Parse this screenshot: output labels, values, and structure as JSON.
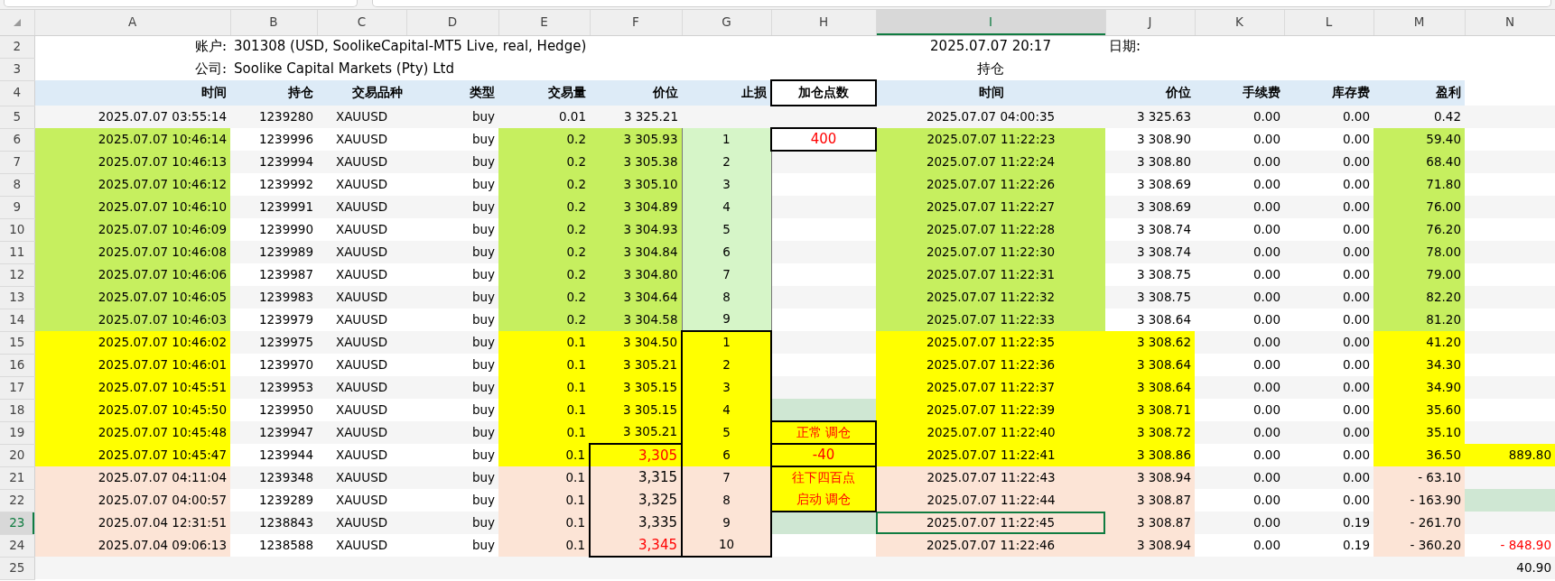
{
  "columns": [
    {
      "label": "A",
      "selected": false
    },
    {
      "label": "B",
      "selected": false
    },
    {
      "label": "C",
      "selected": false
    },
    {
      "label": "D",
      "selected": false
    },
    {
      "label": "E",
      "selected": false
    },
    {
      "label": "F",
      "selected": false
    },
    {
      "label": "G",
      "selected": false
    },
    {
      "label": "H",
      "selected": false
    },
    {
      "label": "I",
      "selected": true
    },
    {
      "label": "J",
      "selected": false
    },
    {
      "label": "K",
      "selected": false
    },
    {
      "label": "L",
      "selected": false
    },
    {
      "label": "M",
      "selected": false
    },
    {
      "label": "N",
      "selected": false
    }
  ],
  "info": {
    "row_numbers": [
      "2",
      "3"
    ],
    "account_label": "账户:",
    "account_value": "301308 (USD, SoolikeCapital-MT5 Live, real, Hedge)",
    "report_time": "2025.07.07 20:17",
    "date_label": "日期:",
    "company_label": "公司:",
    "company_value": "Soolike Capital Markets (Pty) Ltd",
    "section_title": "持仓"
  },
  "header_row": {
    "number": "4",
    "cells": {
      "A": "时间",
      "B": "持仓",
      "C": "交易品种",
      "D": "类型",
      "E": "交易量",
      "F": "价位",
      "G": "止损",
      "H": "加仓点数",
      "I": "时间",
      "J": "价位",
      "K": "手续费",
      "L": "库存费",
      "M": "盈利"
    }
  },
  "rows": [
    {
      "number": "5",
      "kind": "plain",
      "selected": false,
      "cells": {
        "A": "2025.07.07 03:55:14",
        "B": "1239280",
        "C": "XAUUSD",
        "D": "buy",
        "E": "0.01",
        "F": "3 325.21",
        "I": "2025.07.07 04:00:35",
        "J": "3 325.63",
        "K": "0.00",
        "L": "0.00",
        "M": "0.42"
      }
    },
    {
      "number": "6",
      "kind": "green",
      "selected": false,
      "note": {
        "kind": "badge",
        "text": "400"
      },
      "cells": {
        "A": "2025.07.07 10:46:14",
        "B": "1239996",
        "C": "XAUUSD",
        "D": "buy",
        "E": "0.2",
        "F": "3 305.93",
        "G": "1",
        "I": "2025.07.07 11:22:23",
        "J": "3 308.90",
        "K": "0.00",
        "L": "0.00",
        "M": "59.40"
      }
    },
    {
      "number": "7",
      "kind": "green",
      "selected": false,
      "cells": {
        "A": "2025.07.07 10:46:13",
        "B": "1239994",
        "C": "XAUUSD",
        "D": "buy",
        "E": "0.2",
        "F": "3 305.38",
        "G": "2",
        "I": "2025.07.07 11:22:24",
        "J": "3 308.80",
        "K": "0.00",
        "L": "0.00",
        "M": "68.40"
      }
    },
    {
      "number": "8",
      "kind": "green",
      "selected": false,
      "cells": {
        "A": "2025.07.07 10:46:12",
        "B": "1239992",
        "C": "XAUUSD",
        "D": "buy",
        "E": "0.2",
        "F": "3 305.10",
        "G": "3",
        "I": "2025.07.07 11:22:26",
        "J": "3 308.69",
        "K": "0.00",
        "L": "0.00",
        "M": "71.80"
      }
    },
    {
      "number": "9",
      "kind": "green",
      "selected": false,
      "cells": {
        "A": "2025.07.07 10:46:10",
        "B": "1239991",
        "C": "XAUUSD",
        "D": "buy",
        "E": "0.2",
        "F": "3 304.89",
        "G": "4",
        "I": "2025.07.07 11:22:27",
        "J": "3 308.69",
        "K": "0.00",
        "L": "0.00",
        "M": "76.00"
      }
    },
    {
      "number": "10",
      "kind": "green",
      "selected": false,
      "cells": {
        "A": "2025.07.07 10:46:09",
        "B": "1239990",
        "C": "XAUUSD",
        "D": "buy",
        "E": "0.2",
        "F": "3 304.93",
        "G": "5",
        "I": "2025.07.07 11:22:28",
        "J": "3 308.74",
        "K": "0.00",
        "L": "0.00",
        "M": "76.20"
      }
    },
    {
      "number": "11",
      "kind": "green",
      "selected": false,
      "cells": {
        "A": "2025.07.07 10:46:08",
        "B": "1239989",
        "C": "XAUUSD",
        "D": "buy",
        "E": "0.2",
        "F": "3 304.84",
        "G": "6",
        "I": "2025.07.07 11:22:30",
        "J": "3 308.74",
        "K": "0.00",
        "L": "0.00",
        "M": "78.00"
      }
    },
    {
      "number": "12",
      "kind": "green",
      "selected": false,
      "cells": {
        "A": "2025.07.07 10:46:06",
        "B": "1239987",
        "C": "XAUUSD",
        "D": "buy",
        "E": "0.2",
        "F": "3 304.80",
        "G": "7",
        "I": "2025.07.07 11:22:31",
        "J": "3 308.75",
        "K": "0.00",
        "L": "0.00",
        "M": "79.00"
      }
    },
    {
      "number": "13",
      "kind": "green",
      "selected": false,
      "cells": {
        "A": "2025.07.07 10:46:05",
        "B": "1239983",
        "C": "XAUUSD",
        "D": "buy",
        "E": "0.2",
        "F": "3 304.64",
        "G": "8",
        "I": "2025.07.07 11:22:32",
        "J": "3 308.75",
        "K": "0.00",
        "L": "0.00",
        "M": "82.20"
      }
    },
    {
      "number": "14",
      "kind": "green",
      "selected": false,
      "cells": {
        "A": "2025.07.07 10:46:03",
        "B": "1239979",
        "C": "XAUUSD",
        "D": "buy",
        "E": "0.2",
        "F": "3 304.58",
        "G": "9",
        "I": "2025.07.07 11:22:33",
        "J": "3 308.64",
        "K": "0.00",
        "L": "0.00",
        "M": "81.20"
      }
    },
    {
      "number": "15",
      "kind": "yellow",
      "selected": false,
      "cells": {
        "A": "2025.07.07 10:46:02",
        "B": "1239975",
        "C": "XAUUSD",
        "D": "buy",
        "E": "0.1",
        "F": "3 304.50",
        "G": "1",
        "I": "2025.07.07 11:22:35",
        "J": "3 308.62",
        "K": "0.00",
        "L": "0.00",
        "M": "41.20"
      }
    },
    {
      "number": "16",
      "kind": "yellow",
      "selected": false,
      "cells": {
        "A": "2025.07.07 10:46:01",
        "B": "1239970",
        "C": "XAUUSD",
        "D": "buy",
        "E": "0.1",
        "F": "3 305.21",
        "G": "2",
        "I": "2025.07.07 11:22:36",
        "J": "3 308.64",
        "K": "0.00",
        "L": "0.00",
        "M": "34.30"
      }
    },
    {
      "number": "17",
      "kind": "yellow",
      "selected": false,
      "cells": {
        "A": "2025.07.07 10:45:51",
        "B": "1239953",
        "C": "XAUUSD",
        "D": "buy",
        "E": "0.1",
        "F": "3 305.15",
        "G": "3",
        "I": "2025.07.07 11:22:37",
        "J": "3 308.64",
        "K": "0.00",
        "L": "0.00",
        "M": "34.90"
      }
    },
    {
      "number": "18",
      "kind": "yellow",
      "selected": false,
      "note": {
        "kind": "mint"
      },
      "cells": {
        "A": "2025.07.07 10:45:50",
        "B": "1239950",
        "C": "XAUUSD",
        "D": "buy",
        "E": "0.1",
        "F": "3 305.15",
        "G": "4",
        "I": "2025.07.07 11:22:39",
        "J": "3 308.71",
        "K": "0.00",
        "L": "0.00",
        "M": "35.60"
      }
    },
    {
      "number": "19",
      "kind": "yellow",
      "selected": false,
      "note": {
        "kind": "signal",
        "text": "正常 调仓"
      },
      "cells": {
        "A": "2025.07.07 10:45:48",
        "B": "1239947",
        "C": "XAUUSD",
        "D": "buy",
        "E": "0.1",
        "F": "3 305.21",
        "G": "5",
        "I": "2025.07.07 11:22:40",
        "J": "3 308.72",
        "K": "0.00",
        "L": "0.00",
        "M": "35.10"
      }
    },
    {
      "number": "20",
      "kind": "yellow",
      "selected": false,
      "price": {
        "kind": "target_hit",
        "text": "3,305"
      },
      "note": {
        "kind": "signal_value",
        "text": "-40"
      },
      "total": {
        "kind": "gain",
        "text": "889.80"
      },
      "cells": {
        "A": "2025.07.07 10:45:47",
        "B": "1239944",
        "C": "XAUUSD",
        "D": "buy",
        "E": "0.1",
        "G": "6",
        "I": "2025.07.07 11:22:41",
        "J": "3 308.86",
        "K": "0.00",
        "L": "0.00",
        "M": "36.50"
      }
    },
    {
      "number": "21",
      "kind": "peach",
      "selected": false,
      "price": {
        "kind": "target",
        "text": "3,315"
      },
      "note": {
        "kind": "signal_top",
        "text": "往下四百点"
      },
      "cells": {
        "A": "2025.07.07 04:11:04",
        "B": "1239348",
        "C": "XAUUSD",
        "D": "buy",
        "E": "0.1",
        "G": "7",
        "I": "2025.07.07 11:22:43",
        "J": "3 308.94",
        "K": "0.00",
        "L": "0.00",
        "M": "- 63.10"
      }
    },
    {
      "number": "22",
      "kind": "peach",
      "selected": false,
      "price": {
        "kind": "target",
        "text": "3,325"
      },
      "note": {
        "kind": "signal_bottom",
        "text": "启动 调仓"
      },
      "total": {
        "kind": "mint"
      },
      "cells": {
        "A": "2025.07.07 04:00:57",
        "B": "1239289",
        "C": "XAUUSD",
        "D": "buy",
        "E": "0.1",
        "G": "8",
        "I": "2025.07.07 11:22:44",
        "J": "3 308.87",
        "K": "0.00",
        "L": "0.00",
        "M": "- 163.90"
      }
    },
    {
      "number": "23",
      "kind": "peach",
      "selected": true,
      "price": {
        "kind": "target",
        "text": "3,335"
      },
      "note": {
        "kind": "mint"
      },
      "cells": {
        "A": "2025.07.04 12:31:51",
        "B": "1238843",
        "C": "XAUUSD",
        "D": "buy",
        "E": "0.1",
        "G": "9",
        "I": "2025.07.07 11:22:45",
        "J": "3 308.87",
        "K": "0.00",
        "L": "0.19",
        "M": "- 261.70"
      }
    },
    {
      "number": "24",
      "kind": "peach",
      "selected": false,
      "price": {
        "kind": "target_hit",
        "text": "3,345"
      },
      "total": {
        "kind": "loss",
        "text": "- 848.90"
      },
      "cells": {
        "A": "2025.07.04 09:06:13",
        "B": "1238588",
        "C": "XAUUSD",
        "D": "buy",
        "E": "0.1",
        "G": "10",
        "I": "2025.07.07 11:22:46",
        "J": "3 308.94",
        "K": "0.00",
        "L": "0.19",
        "M": "- 360.20"
      }
    },
    {
      "number": "25",
      "kind": "plain",
      "selected": false,
      "cells": {
        "N": "40.90"
      }
    }
  ]
}
